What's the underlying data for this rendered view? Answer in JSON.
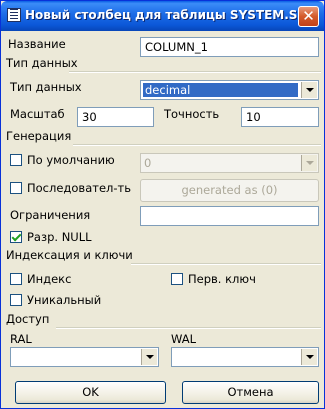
{
  "window": {
    "title": "Новый столбец для таблицы SYSTEM.SE...",
    "close_label": "✕"
  },
  "name_field": {
    "label": "Название",
    "value": "COLUMN_1"
  },
  "data_type_section": {
    "title": "Тип данных",
    "type_label": "Тип данных",
    "type_value": "decimal",
    "scale_label": "Масштаб",
    "scale_value": "30",
    "precision_label": "Точность",
    "precision_value": "10"
  },
  "generation_section": {
    "title": "Генерация",
    "default_label": "По умолчанию",
    "default_checked": false,
    "default_value": "0",
    "sequence_label": "Последовател-ть",
    "sequence_checked": false,
    "generated_button_label": "generated as (0)",
    "constraints_label": "Ограничения",
    "constraints_value": "",
    "allow_null_label": "Разр. NULL",
    "allow_null_checked": true
  },
  "index_section": {
    "title": "Индексация и ключи",
    "index_label": "Индекс",
    "primary_key_label": "Перв. ключ",
    "unique_label": "Уникальный"
  },
  "access_section": {
    "title": "Доступ",
    "ral_label": "RAL",
    "ral_value": "",
    "wal_label": "WAL",
    "wal_value": ""
  },
  "buttons": {
    "ok_label": "OK",
    "cancel_label": "Отмена"
  },
  "colors": {
    "titlebar": "#0b57d8",
    "selection": "#316ac5",
    "dialog_bg": "#ece9d8"
  }
}
